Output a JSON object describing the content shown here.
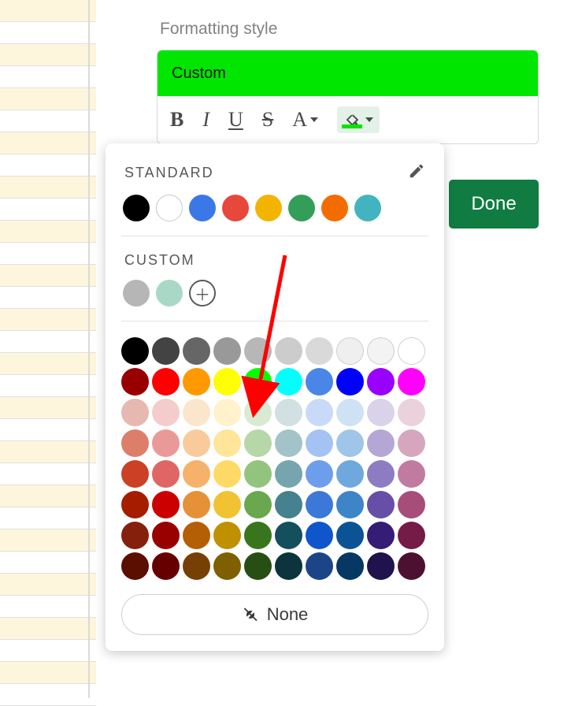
{
  "sidebar": {
    "label": "Formatting style",
    "preview_label": "Custom",
    "preview_fill": "#00e600",
    "tools": {
      "bold": "B",
      "italic": "I",
      "underline": "U",
      "strike": "S",
      "textcolor": "A"
    },
    "done_label": "Done"
  },
  "picker": {
    "standard_title": "STANDARD",
    "custom_title": "CUSTOM",
    "none_label": "None",
    "standard": [
      "#000000",
      "#ffffff",
      "#3b78e7",
      "#e8483b",
      "#f3b400",
      "#339e58",
      "#f36c00",
      "#42b4c0"
    ],
    "custom_recent": [
      "#b6b6b6",
      "#a9d9c6"
    ],
    "palette": [
      [
        "#000000",
        "#434343",
        "#666666",
        "#999999",
        "#b7b7b7",
        "#cccccc",
        "#d9d9d9",
        "#efefef",
        "#f3f3f3",
        "#ffffff"
      ],
      [
        "#980000",
        "#ff0000",
        "#ff9900",
        "#ffff00",
        "#00ff00",
        "#00ffff",
        "#4a86e8",
        "#0000ff",
        "#9900ff",
        "#ff00ff"
      ],
      [
        "#e6b8af",
        "#f4cccc",
        "#fce5cd",
        "#fff2cc",
        "#d9ead3",
        "#d0e0e3",
        "#c9daf8",
        "#cfe2f3",
        "#d9d2e9",
        "#ead1dc"
      ],
      [
        "#dd7e6b",
        "#ea9999",
        "#f9cb9c",
        "#ffe599",
        "#b6d7a8",
        "#a2c4c9",
        "#a4c2f4",
        "#9fc5e8",
        "#b4a7d6",
        "#d5a6bd"
      ],
      [
        "#cc4125",
        "#e06666",
        "#f6b26b",
        "#ffd966",
        "#93c47d",
        "#76a5af",
        "#6d9eeb",
        "#6fa8dc",
        "#8e7cc3",
        "#c27ba0"
      ],
      [
        "#a61c00",
        "#cc0000",
        "#e69138",
        "#f1c232",
        "#6aa84f",
        "#45818e",
        "#3c78d8",
        "#3d85c6",
        "#674ea7",
        "#a64d79"
      ],
      [
        "#85200c",
        "#990000",
        "#b45f06",
        "#bf9000",
        "#38761d",
        "#134f5c",
        "#1155cc",
        "#0b5394",
        "#351c75",
        "#741b47"
      ],
      [
        "#5b0f00",
        "#660000",
        "#783f04",
        "#7f6000",
        "#274e13",
        "#0c343d",
        "#1c4587",
        "#073763",
        "#20124d",
        "#4c1130"
      ]
    ],
    "selected": {
      "row": 1,
      "col": 4
    }
  },
  "sheet_band_pattern": [
    true,
    false,
    true,
    false,
    true,
    false,
    true,
    false,
    true,
    false,
    true,
    false,
    true,
    false,
    true,
    false,
    true,
    false,
    true,
    false,
    true,
    false,
    true,
    false,
    true,
    false,
    true,
    false,
    true,
    false,
    true,
    false
  ]
}
